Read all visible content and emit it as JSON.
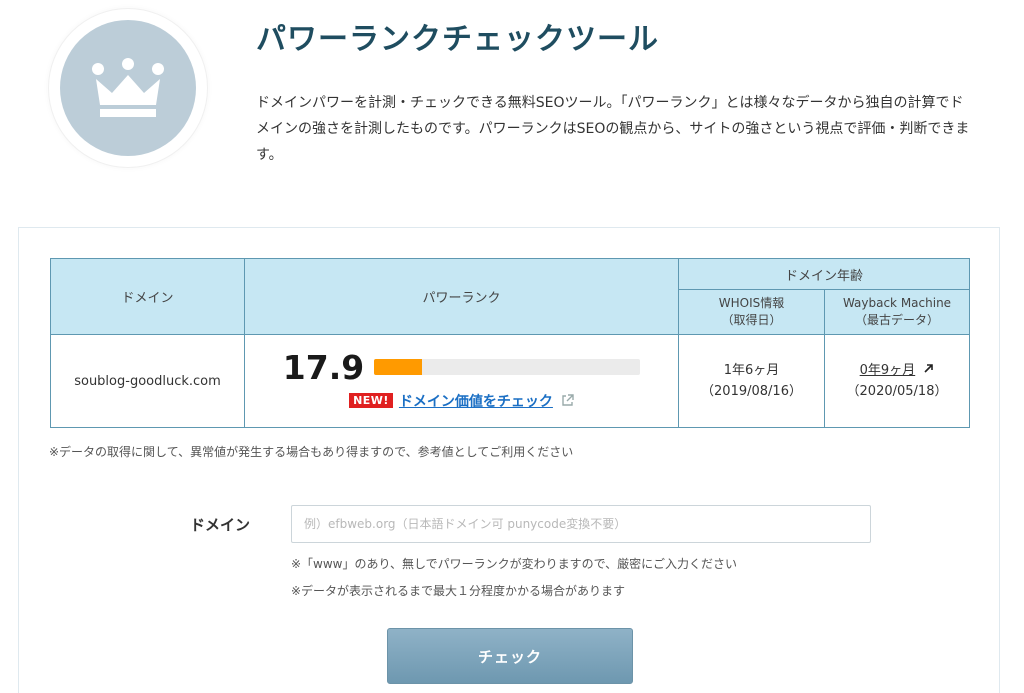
{
  "header": {
    "title": "パワーランクチェックツール",
    "description": "ドメインパワーを計測・チェックできる無料SEOツール。「パワーランク」とは様々なデータから独自の計算でドメインの強さを計測したものです。パワーランクはSEOの観点から、サイトの強さという視点で評価・判断できます。",
    "logo_icon": "crown-icon"
  },
  "table": {
    "col_domain": "ドメイン",
    "col_rank": "パワーランク",
    "col_age": "ドメイン年齢",
    "col_whois": "WHOIS情報",
    "col_whois_sub": "（取得日）",
    "col_wayback": "Wayback Machine",
    "col_wayback_sub": "（最古データ）",
    "row": {
      "domain": "soublog-goodluck.com",
      "rank": "17.9",
      "rank_fraction": 0.179,
      "new_badge": "NEW!",
      "value_link": "ドメイン価値をチェック",
      "whois_age": "1年6ヶ月",
      "whois_date": "（2019/08/16）",
      "wayback_age": "0年9ヶ月",
      "wayback_date": "（2020/05/18）"
    }
  },
  "note": "※データの取得に関して、異常値が発生する場合もあり得ますので、参考値としてご利用ください",
  "form": {
    "label": "ドメイン",
    "placeholder": "例）efbweb.org（日本語ドメイン可 punycode変換不要）",
    "value": "",
    "hint1": "※「www」のあり、無しでパワーランクが変わりますので、厳密にご入力ください",
    "hint2": "※データが表示されるまで最大１分程度かかる場合があります",
    "button": "チェック"
  },
  "colors": {
    "accent": "#ff9a00",
    "header_bg": "#c6e7f3",
    "border": "#5e98b1",
    "title": "#1f4d60",
    "button": "#7ba3ba",
    "badge": "#e02020",
    "link": "#1b6fc4"
  }
}
